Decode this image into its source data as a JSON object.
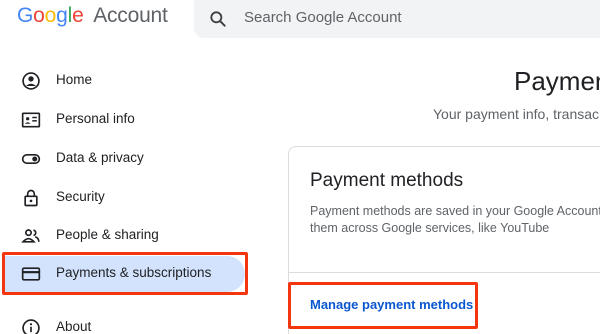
{
  "header": {
    "brand_letters": [
      "G",
      "o",
      "o",
      "g",
      "l",
      "e"
    ],
    "brand_colors": [
      "#4285f4",
      "#ea4335",
      "#fbbc05",
      "#4285f4",
      "#34a853",
      "#ea4335"
    ],
    "product": "Account",
    "search_placeholder": "Search Google Account",
    "search_icon": "search-icon"
  },
  "sidebar": {
    "items": [
      {
        "label": "Home",
        "icon": "account-circle-icon"
      },
      {
        "label": "Personal info",
        "icon": "id-card-icon"
      },
      {
        "label": "Data & privacy",
        "icon": "toggle-icon"
      },
      {
        "label": "Security",
        "icon": "lock-icon"
      },
      {
        "label": "People & sharing",
        "icon": "people-icon"
      },
      {
        "label": "Payments & subscriptions",
        "icon": "credit-card-icon",
        "active": true
      },
      {
        "label": "About",
        "icon": "info-icon"
      }
    ]
  },
  "main": {
    "title": "Paymen",
    "subtitle": "Your payment info, transac",
    "card": {
      "title": "Payment methods",
      "desc_line1": "Payment methods are saved in your Google Account",
      "desc_line2": "them across Google services, like YouTube",
      "link": "Manage payment methods"
    }
  },
  "colors": {
    "active_bg": "#d3e3fd",
    "highlight": "#f4360e",
    "link": "#0b57d0"
  }
}
